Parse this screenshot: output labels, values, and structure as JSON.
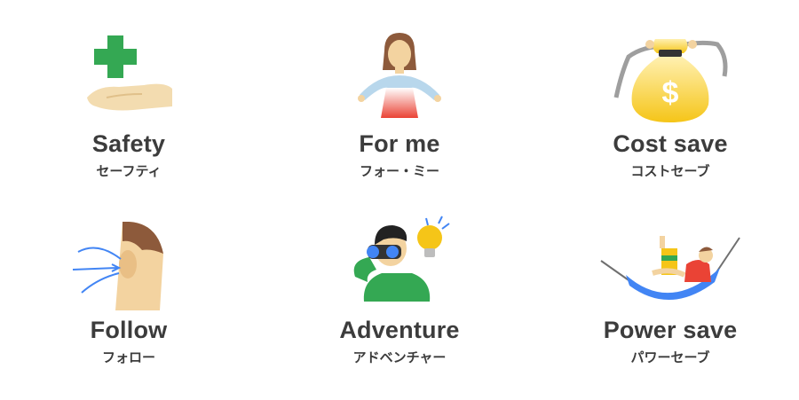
{
  "items": [
    {
      "title": "Safety",
      "subtitle": "セーフティ",
      "icon": "hand-with-green-cross-icon"
    },
    {
      "title": "For me",
      "subtitle": "フォー・ミー",
      "icon": "woman-open-arms-icon"
    },
    {
      "title": "Cost save",
      "subtitle": "コストセーブ",
      "icon": "money-bag-icon"
    },
    {
      "title": "Follow",
      "subtitle": "フォロー",
      "icon": "listening-ear-icon"
    },
    {
      "title": "Adventure",
      "subtitle": "アドベンチャー",
      "icon": "binoculars-lightbulb-icon"
    },
    {
      "title": "Power save",
      "subtitle": "パワーセーブ",
      "icon": "hammock-relax-icon"
    }
  ],
  "colors": {
    "text": "#3c3c3c",
    "green": "#34a853",
    "gold": "#f5c518",
    "red": "#ea4335",
    "blue": "#4285f4"
  }
}
